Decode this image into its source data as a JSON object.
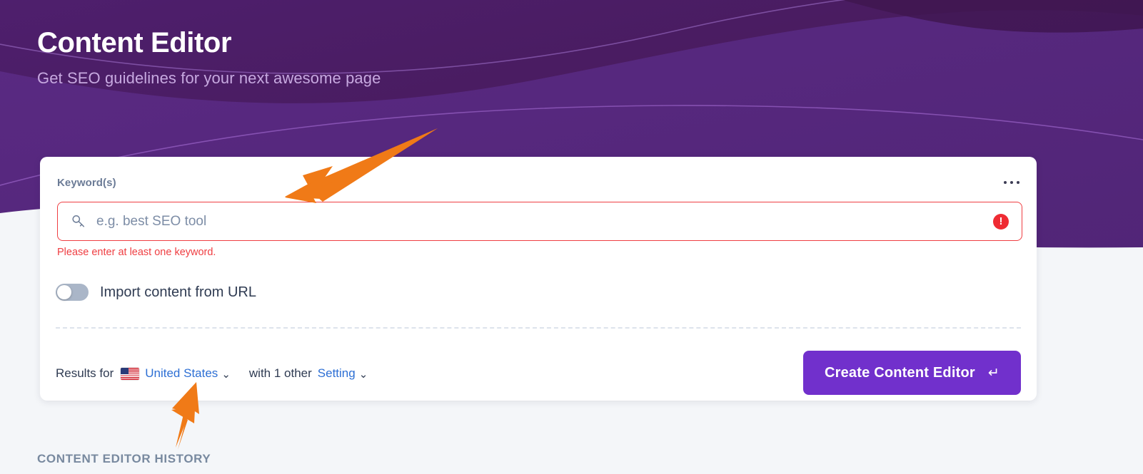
{
  "hero": {
    "title": "Content Editor",
    "subtitle": "Get SEO guidelines for your next awesome page",
    "bg_dark": "#4a1d68",
    "bg_light": "#56277e",
    "subtitle_color": "#c7a9e0"
  },
  "card": {
    "keyword_label": "Keyword(s)",
    "overflow_menu": "more-options",
    "keyword_input": {
      "value": "",
      "placeholder": "e.g. best SEO tool",
      "icon": "key-icon",
      "state_icon": "error-exclamation-icon",
      "border_color": "#ef3e42"
    },
    "error_message": "Please enter at least one keyword.",
    "error_color": "#ef3e42",
    "import_toggle": {
      "label": "Import content from URL",
      "checked": false
    },
    "settings_row": {
      "prefix": "Results for",
      "country": "United States",
      "country_flag": "flag-united-states",
      "country_chevron": "⌄",
      "middle_text": "with 1 other",
      "setting_link": "Setting",
      "setting_chevron": "⌄",
      "link_color": "#2d6fd4"
    },
    "create_button": {
      "label": "Create Content Editor",
      "enter_glyph": "↵",
      "color": "#7130cc"
    }
  },
  "history": {
    "heading": "CONTENT EDITOR HISTORY"
  },
  "annotations": {
    "arrow_color": "#f07a17",
    "arrow_keyword_input": "arrow-pointing-to-keyword-input",
    "arrow_country_selector": "arrow-pointing-to-country-selector"
  }
}
